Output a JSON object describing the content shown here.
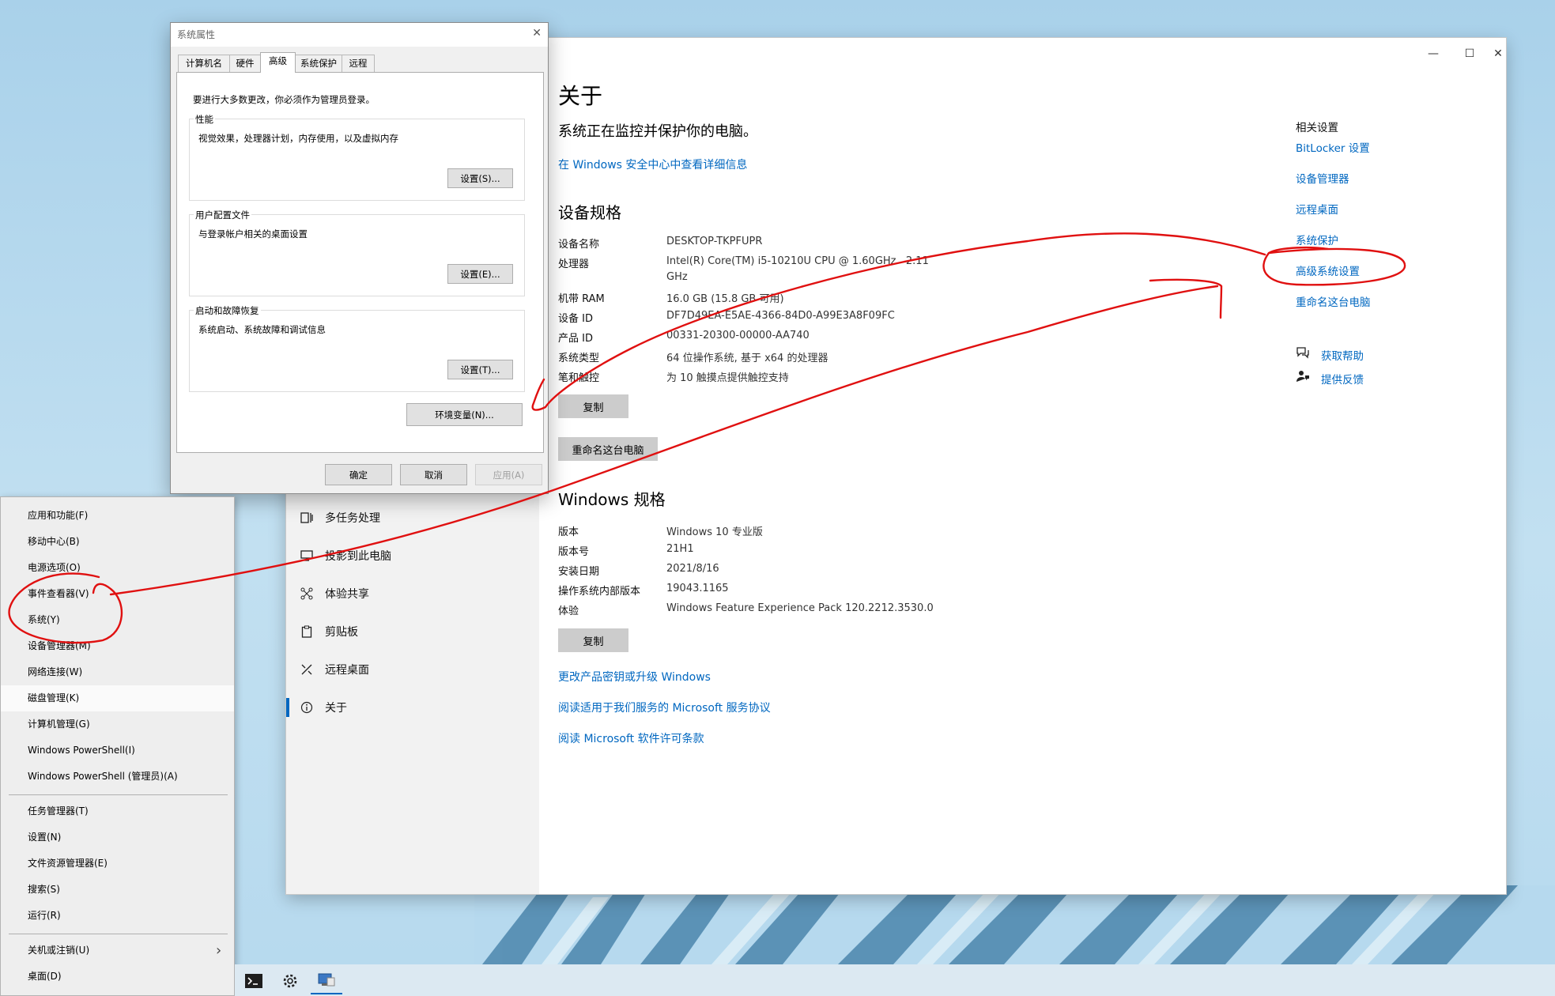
{
  "settings": {
    "nav_items": [
      {
        "label": "多任务处理",
        "icon": "multitask-icon"
      },
      {
        "label": "投影到此电脑",
        "icon": "project-icon"
      },
      {
        "label": "体验共享",
        "icon": "share-icon"
      },
      {
        "label": "剪贴板",
        "icon": "clipboard-icon"
      },
      {
        "label": "远程桌面",
        "icon": "remote-desktop-icon"
      },
      {
        "label": "关于",
        "icon": "info-icon",
        "active": true
      }
    ],
    "title": "关于",
    "protect_text": "系统正在监控并保护你的电脑。",
    "security_link": "在 Windows 安全中心中查看详细信息",
    "device_spec_heading": "设备规格",
    "device_specs": [
      {
        "label": "设备名称",
        "value": "DESKTOP-TKPFUPR"
      },
      {
        "label": "处理器",
        "value": "Intel(R) Core(TM) i5-10210U CPU @ 1.60GHz   2.11",
        "value2": "GHz"
      },
      {
        "label": "机带 RAM",
        "value": "16.0 GB (15.8 GB 可用)"
      },
      {
        "label": "设备 ID",
        "value": "DF7D49EA-E5AE-4366-84D0-A99E3A8F09FC"
      },
      {
        "label": "产品 ID",
        "value": "00331-20300-00000-AA740"
      },
      {
        "label": "系统类型",
        "value": "64 位操作系统, 基于 x64 的处理器"
      },
      {
        "label": "笔和触控",
        "value": "为 10 触摸点提供触控支持"
      }
    ],
    "copy_label": "复制",
    "rename_label": "重命名这台电脑",
    "windows_spec_heading": "Windows 规格",
    "windows_specs": [
      {
        "label": "版本",
        "value": "Windows 10 专业版"
      },
      {
        "label": "版本号",
        "value": "21H1"
      },
      {
        "label": "安装日期",
        "value": "2021/8/16"
      },
      {
        "label": "操作系统内部版本",
        "value": "19043.1165"
      },
      {
        "label": "体验",
        "value": "Windows Feature Experience Pack 120.2212.3530.0"
      }
    ],
    "copy_label2": "复制",
    "bottom_links": [
      "更改产品密钥或升级 Windows",
      "阅读适用于我们服务的 Microsoft 服务协议",
      "阅读 Microsoft 软件许可条款"
    ],
    "related": {
      "heading": "相关设置",
      "links": [
        "BitLocker 设置",
        "设备管理器",
        "远程桌面",
        "系统保护",
        "高级系统设置",
        "重命名这台电脑"
      ],
      "help": "获取帮助",
      "feedback": "提供反馈"
    },
    "window_buttons": {
      "minimize": "—",
      "maximize": "☐",
      "close": "✕"
    }
  },
  "sysprop": {
    "title": "系统属性",
    "close": "✕",
    "tabs": [
      "计算机名",
      "硬件",
      "高级",
      "系统保护",
      "远程"
    ],
    "admin_note": "要进行大多数更改，你必须作为管理员登录。",
    "groups": [
      {
        "title": "性能",
        "desc": "视觉效果，处理器计划，内存使用，以及虚拟内存",
        "button": "设置(S)..."
      },
      {
        "title": "用户配置文件",
        "desc": "与登录帐户相关的桌面设置",
        "button": "设置(E)..."
      },
      {
        "title": "启动和故障恢复",
        "desc": "系统启动、系统故障和调试信息",
        "button": "设置(T)..."
      }
    ],
    "env_button": "环境变量(N)...",
    "ok": "确定",
    "cancel": "取消",
    "apply": "应用(A)"
  },
  "context_menu": {
    "items": [
      "应用和功能(F)",
      "移动中心(B)",
      "电源选项(O)",
      "事件查看器(V)",
      "系统(Y)",
      "设备管理器(M)",
      "网络连接(W)",
      "磁盘管理(K)",
      "计算机管理(G)",
      "Windows PowerShell(I)",
      "Windows PowerShell (管理员)(A)",
      "任务管理器(T)",
      "设置(N)",
      "文件资源管理器(E)",
      "搜索(S)",
      "运行(R)",
      "关机或注销(U)",
      "桌面(D)"
    ],
    "submenu_arrow": "›"
  },
  "taskbar": {
    "icons": [
      "terminal-icon",
      "settings-gear-icon",
      "system-properties-icon"
    ]
  },
  "colors": {
    "accent": "#0067c0",
    "annotation": "#e01010"
  }
}
